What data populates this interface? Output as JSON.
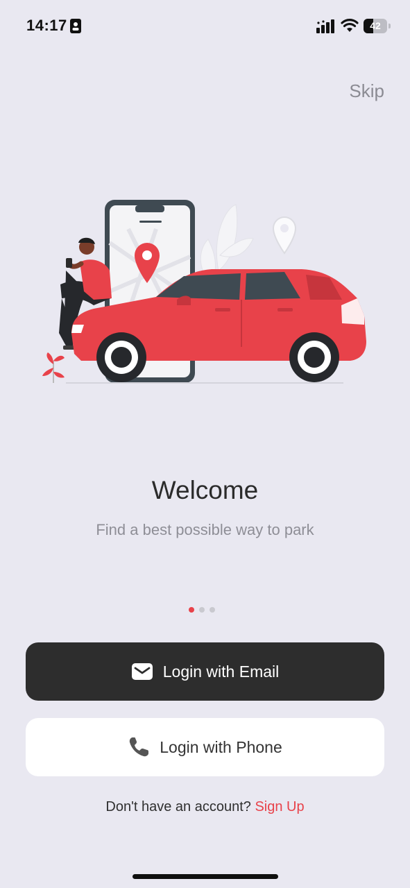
{
  "status_bar": {
    "time": "14:17",
    "battery": "42",
    "battery_level": 0.42,
    "icons": [
      "contact-card-icon",
      "cellular-signal-icon",
      "wifi-icon",
      "battery-icon"
    ]
  },
  "header": {
    "skip_label": "Skip"
  },
  "hero": {
    "illustration": "person-sitting-on-red-car-with-phone-map-illustration",
    "title": "Welcome",
    "subtitle": "Find a best possible way to park"
  },
  "pagination": {
    "total": 3,
    "active_index": 0
  },
  "actions": {
    "email_button": {
      "label": "Login with Email",
      "icon": "envelope-icon"
    },
    "phone_button": {
      "label": "Login with Phone",
      "icon": "phone-icon"
    }
  },
  "footer": {
    "prompt": "Don't have an account?",
    "signup_label": "Sign Up"
  },
  "colors": {
    "background": "#e9e8f1",
    "accent": "#e8424a",
    "primary_button": "#2d2d2d",
    "secondary_button": "#ffffff",
    "muted_text": "#8e8e96"
  }
}
